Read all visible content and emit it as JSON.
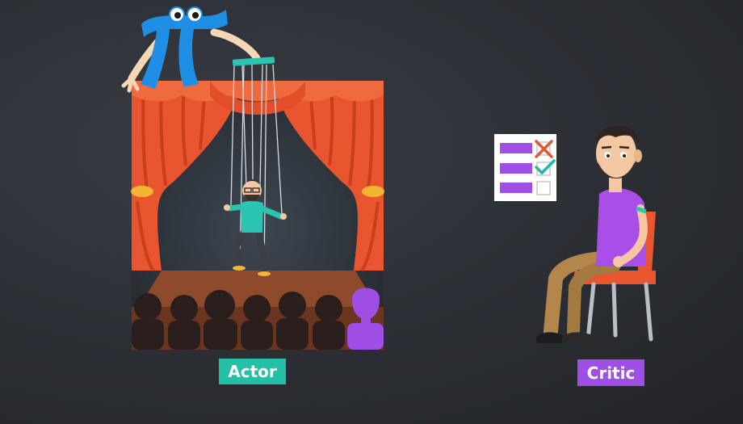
{
  "labels": {
    "actor": "Actor",
    "critic": "Critic"
  },
  "colors": {
    "background": "#2b2e34",
    "actor_label": "#22c0a6",
    "critic_label": "#9f4fe6",
    "curtain": "#e9552f",
    "stage_floor": "#8b4a2c",
    "puppet_shirt": "#2bc4b0",
    "critic_shirt": "#a94fe8",
    "pi_mascot": "#1f8fe6"
  },
  "checklist": [
    {
      "status": "cross"
    },
    {
      "status": "check"
    },
    {
      "status": "empty"
    }
  ],
  "icons": {
    "mascot": "pi-mascot-icon",
    "puppet": "puppet-icon",
    "critic": "critic-person-icon",
    "checklist": "checklist-icon"
  }
}
